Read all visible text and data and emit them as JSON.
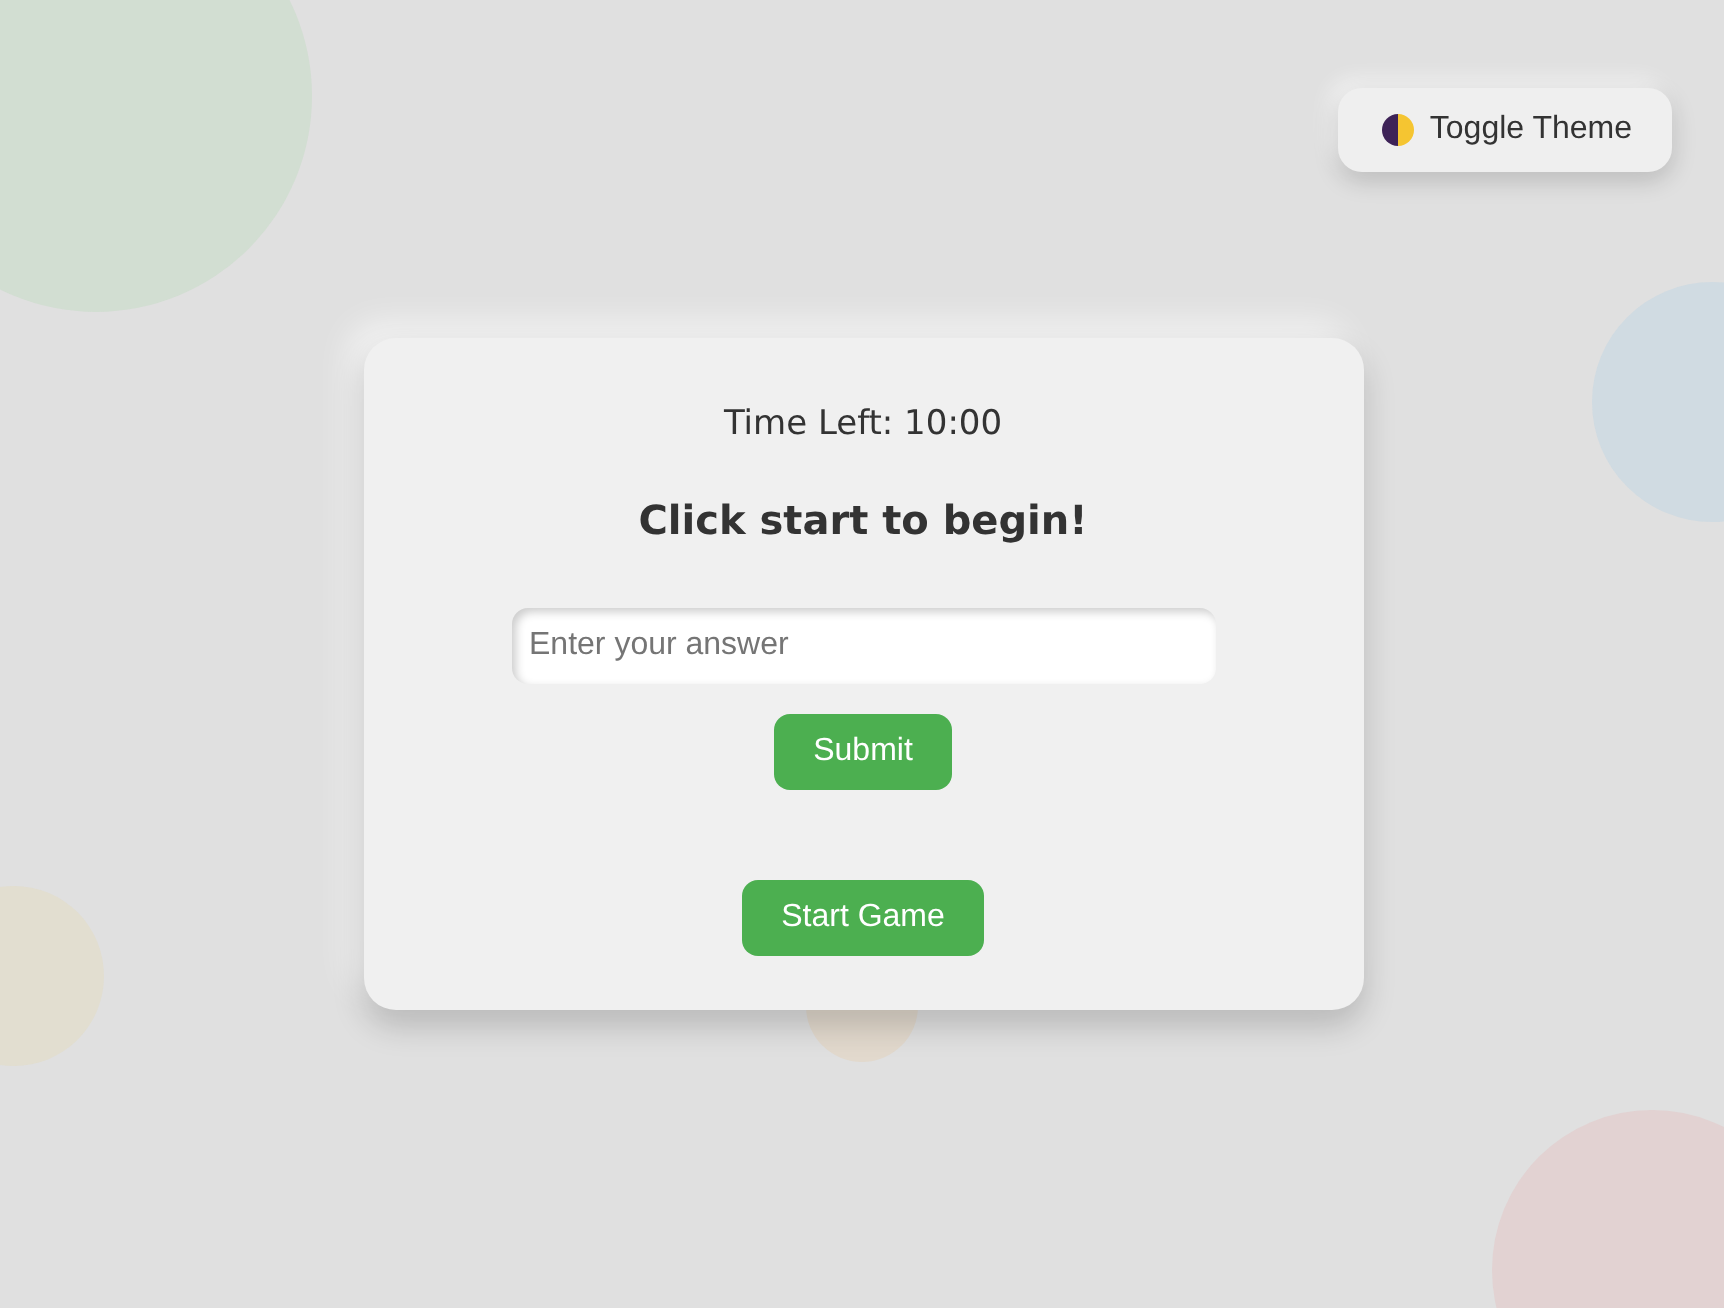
{
  "theme_toggle": {
    "label": "Toggle Theme"
  },
  "game": {
    "timer": "Time Left: 10:00",
    "message": "Click start to begin!",
    "answer": {
      "placeholder": "Enter your answer"
    },
    "submit": "Submit",
    "start": "Start Game"
  }
}
